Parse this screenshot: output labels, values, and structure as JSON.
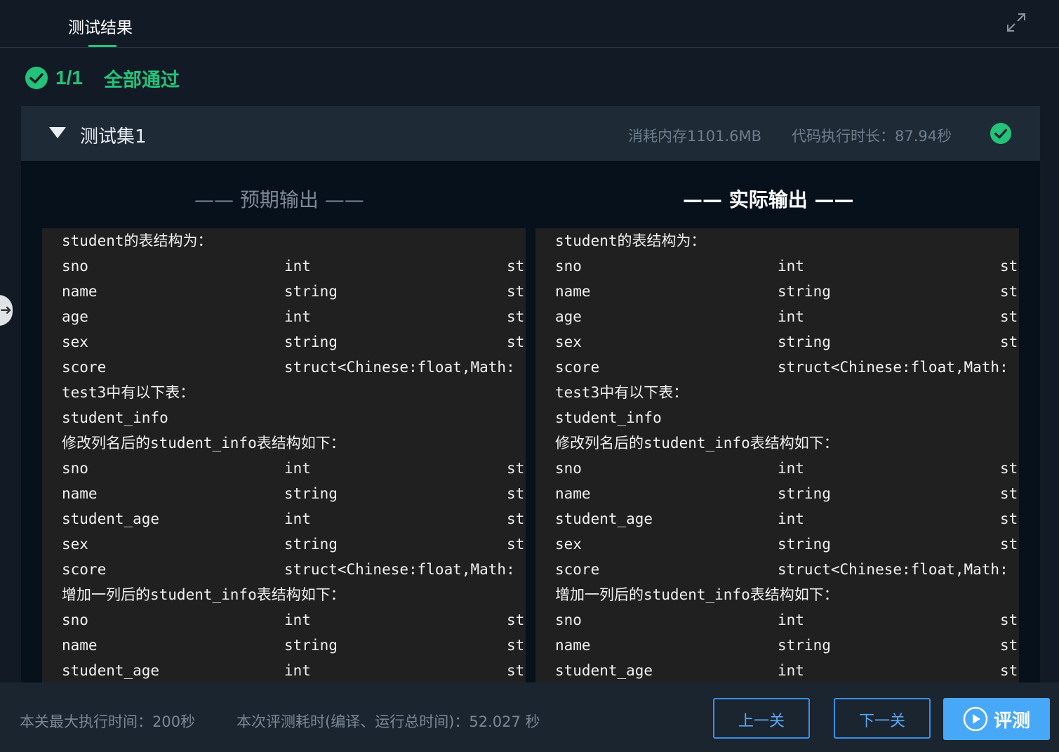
{
  "tabs": {
    "active_label": "测试结果"
  },
  "summary": {
    "count": "1/1",
    "status": "全部通过"
  },
  "test_set": {
    "title": "测试集1",
    "memory": "消耗内存1101.6MB",
    "exec_time": "代码执行时长：87.94秒"
  },
  "output": {
    "expected_heading": "—— 预期输出 ——",
    "actual_heading": "—— 实际输出 ——",
    "expected_lines": [
      [
        "student的表结构为：",
        "",
        ""
      ],
      [
        "sno",
        "int",
        "st"
      ],
      [
        "name",
        "string",
        "st"
      ],
      [
        "age",
        "int",
        "st"
      ],
      [
        "sex",
        "string",
        "st"
      ],
      [
        "score",
        "struct<Chinese:float,Math:",
        ""
      ],
      [
        "test3中有以下表：",
        "",
        ""
      ],
      [
        "student_info",
        "",
        ""
      ],
      [
        "修改列名后的student_info表结构如下：",
        "",
        ""
      ],
      [
        "sno",
        "int",
        "st"
      ],
      [
        "name",
        "string",
        "st"
      ],
      [
        "student_age",
        "int",
        "st"
      ],
      [
        "sex",
        "string",
        "st"
      ],
      [
        "score",
        "struct<Chinese:float,Math:",
        ""
      ],
      [
        "增加一列后的student_info表结构如下：",
        "",
        ""
      ],
      [
        "sno",
        "int",
        "st"
      ],
      [
        "name",
        "string",
        "st"
      ],
      [
        "student_age",
        "int",
        "st"
      ]
    ],
    "actual_lines": [
      [
        "student的表结构为：",
        "",
        ""
      ],
      [
        "sno",
        "int",
        "st"
      ],
      [
        "name",
        "string",
        "st"
      ],
      [
        "age",
        "int",
        "st"
      ],
      [
        "sex",
        "string",
        "st"
      ],
      [
        "score",
        "struct<Chinese:float,Math:",
        ""
      ],
      [
        "test3中有以下表：",
        "",
        ""
      ],
      [
        "student_info",
        "",
        ""
      ],
      [
        "修改列名后的student_info表结构如下：",
        "",
        ""
      ],
      [
        "sno",
        "int",
        "st"
      ],
      [
        "name",
        "string",
        "st"
      ],
      [
        "student_age",
        "int",
        "st"
      ],
      [
        "sex",
        "string",
        "st"
      ],
      [
        "score",
        "struct<Chinese:float,Math:",
        ""
      ],
      [
        "增加一列后的student_info表结构如下：",
        "",
        ""
      ],
      [
        "sno",
        "int",
        "st"
      ],
      [
        "name",
        "string",
        "st"
      ],
      [
        "student_age",
        "int",
        "st"
      ]
    ]
  },
  "footer": {
    "max_time": "本关最大执行时间：200秒",
    "cost_time": "本次评测耗时(编译、运行总时间)：52.027 秒",
    "prev_label": "上一关",
    "next_label": "下一关",
    "eval_label": "评测"
  },
  "colors": {
    "success": "#25c27a",
    "primary": "#48a8f8"
  },
  "icons": [
    "check-circle-icon",
    "expand-icon",
    "caret-down-icon",
    "play-circle-icon",
    "arrow-right-icon"
  ]
}
